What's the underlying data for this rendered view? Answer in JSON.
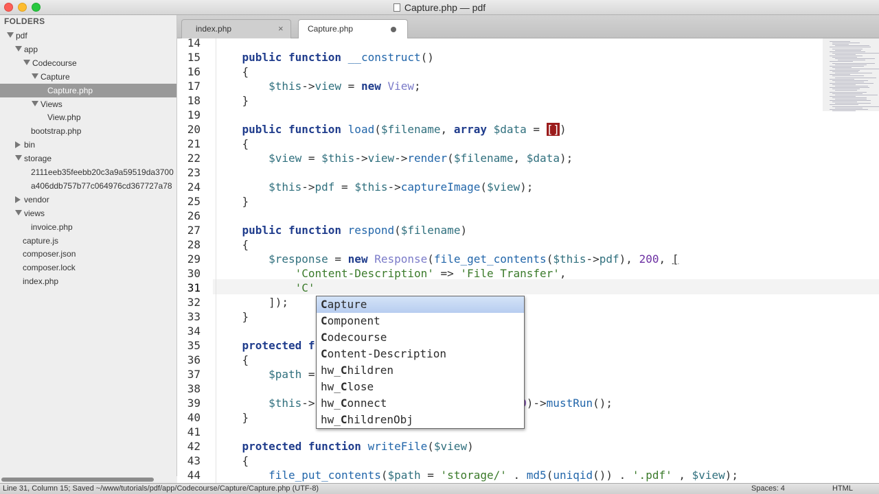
{
  "window": {
    "title": "Capture.php — pdf"
  },
  "sidebar": {
    "header": "FOLDERS",
    "items": [
      {
        "label": "pdf",
        "depth": 0,
        "type": "folder-open"
      },
      {
        "label": "app",
        "depth": 1,
        "type": "folder-open"
      },
      {
        "label": "Codecourse",
        "depth": 2,
        "type": "folder-open"
      },
      {
        "label": "Capture",
        "depth": 3,
        "type": "folder-open"
      },
      {
        "label": "Capture.php",
        "depth": 4,
        "type": "file",
        "selected": true
      },
      {
        "label": "Views",
        "depth": 3,
        "type": "folder-open"
      },
      {
        "label": "View.php",
        "depth": 4,
        "type": "file"
      },
      {
        "label": "bootstrap.php",
        "depth": 2,
        "type": "file"
      },
      {
        "label": "bin",
        "depth": 1,
        "type": "folder-closed"
      },
      {
        "label": "storage",
        "depth": 1,
        "type": "folder-open"
      },
      {
        "label": "2111eeb35feebb20c3a9a59519da3700",
        "depth": 2,
        "type": "file"
      },
      {
        "label": "a406ddb757b77c064976cd367727a78",
        "depth": 2,
        "type": "file"
      },
      {
        "label": "vendor",
        "depth": 1,
        "type": "folder-closed"
      },
      {
        "label": "views",
        "depth": 1,
        "type": "folder-open"
      },
      {
        "label": "invoice.php",
        "depth": 2,
        "type": "file"
      },
      {
        "label": "capture.js",
        "depth": 1,
        "type": "file"
      },
      {
        "label": "composer.json",
        "depth": 1,
        "type": "file"
      },
      {
        "label": "composer.lock",
        "depth": 1,
        "type": "file"
      },
      {
        "label": "index.php",
        "depth": 1,
        "type": "file"
      }
    ]
  },
  "tabs": [
    {
      "label": "index.php",
      "active": false
    },
    {
      "label": "Capture.php",
      "active": true,
      "dirty": true
    }
  ],
  "editor": {
    "line_numbers": [
      "14",
      "15",
      "16",
      "17",
      "18",
      "19",
      "20",
      "21",
      "22",
      "23",
      "24",
      "25",
      "26",
      "27",
      "28",
      "29",
      "30",
      "31",
      "32",
      "33",
      "34",
      "35",
      "36",
      "37",
      "38",
      "39",
      "40",
      "41",
      "42",
      "43",
      "44"
    ],
    "current_line": "31"
  },
  "autocomplete": {
    "items": [
      "Capture",
      "Component",
      "Codecourse",
      "Content-Description",
      "hw_Children",
      "hw_Close",
      "hw_Connect",
      "hw_ChildrenObj"
    ],
    "selected": "Capture"
  },
  "status": {
    "left": "Line 31, Column 15; Saved ~/www/tutorials/pdf/app/Codecourse/Capture/Capture.php (UTF-8)",
    "spaces": "Spaces: 4",
    "syntax": "HTML"
  },
  "colors": {
    "close": "#fc5f57",
    "minimize": "#fdbc2e",
    "zoom": "#28c840",
    "selection": "#999999",
    "bracket_highlight": "#9b1c1c"
  }
}
